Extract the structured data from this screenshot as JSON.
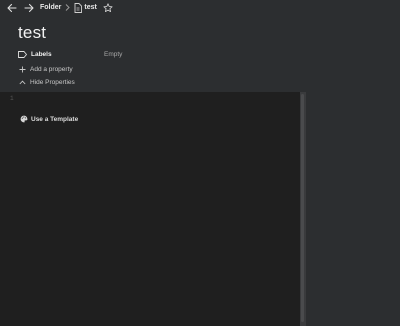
{
  "breadcrumb": {
    "items": [
      {
        "label": "Folder"
      },
      {
        "label": "test"
      }
    ]
  },
  "page": {
    "title": "test"
  },
  "properties": [
    {
      "name": "Labels",
      "value": "Empty",
      "icon": "label-icon"
    }
  ],
  "actions": {
    "add_property": "Add a property",
    "hide_properties": "Hide Properties"
  },
  "editor": {
    "line_number": "1",
    "template_label": "Use a Template"
  },
  "colors": {
    "header_bg": "#2c2e30",
    "editor_bg": "#1f1f1f",
    "text": "#e6e6e6",
    "muted": "#a8a8a8"
  }
}
